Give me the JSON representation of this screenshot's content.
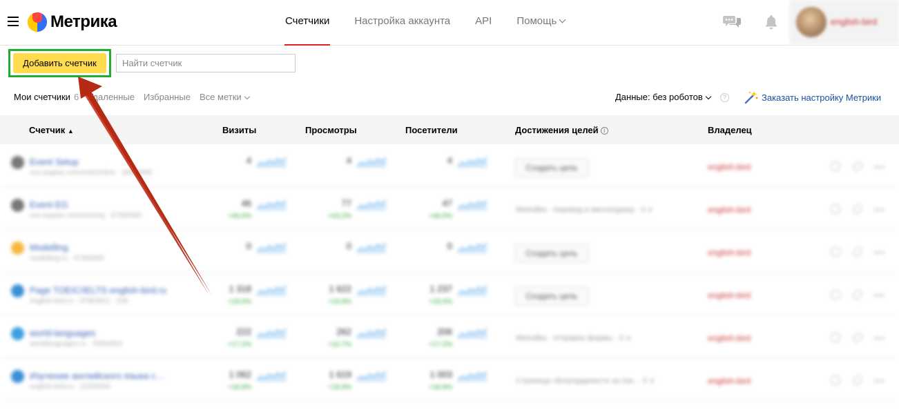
{
  "header": {
    "logo_text": "Метрика",
    "nav": [
      {
        "label": "Счетчики",
        "active": true
      },
      {
        "label": "Настройка аккаунта",
        "active": false
      },
      {
        "label": "API",
        "active": false
      },
      {
        "label": "Помощь",
        "active": false,
        "dropdown": true
      }
    ],
    "icons": [
      "chat-icon",
      "bell-icon"
    ],
    "profile_name": "english-bird"
  },
  "toolbar": {
    "add_button_label": "Добавить счетчик",
    "search_placeholder": "Найти счетчик",
    "highlight_color": "#1fae2f",
    "add_button_color": "#ffdb4d"
  },
  "tabs": [
    {
      "label": "Мои счетчики",
      "count": "6",
      "active": true
    },
    {
      "label": "Удаленные",
      "active": false
    },
    {
      "label": "Избранные",
      "active": false
    },
    {
      "label": "Все метки",
      "active": false,
      "dropdown": true
    }
  ],
  "data_filter": "Данные: без роботов",
  "help_symbol": "?",
  "order_link": "Заказать настройку Метрики",
  "table": {
    "columns": {
      "counter": "Счетчик",
      "sort_indicator": "▲",
      "visits": "Визиты",
      "views": "Просмотры",
      "visitors": "Посетители",
      "goals": "Достижения целей",
      "goals_info": "i",
      "owner": "Владелец"
    },
    "rows": [
      {
        "name": "Event Setup",
        "sub": "сoo.яндекс.ru/events/online · 26959466",
        "visits": "4",
        "views": "4",
        "visitors": "4",
        "visits_delta": "",
        "views_delta": "",
        "visitors_delta": "",
        "goal_button": "Создать цель",
        "goal_text": "",
        "owner": "english-bird",
        "icon_color": "#777"
      },
      {
        "name": "Event EG",
        "sub": "сoo.яндекс.ru/events/eg · 57690666",
        "visits": "46",
        "views": "77",
        "visitors": "47",
        "visits_delta": "+46.0%",
        "views_delta": "+43.2%",
        "visitors_delta": "+46.0%",
        "goal_button": "",
        "goal_text": "Metodika · перевод в мессенджер · 0 ∨",
        "owner": "english-bird",
        "icon_color": "#777"
      },
      {
        "name": "Modelling",
        "sub": "modelling.ru · 47365493",
        "visits": "0",
        "views": "0",
        "visitors": "0",
        "visits_delta": "",
        "views_delta": "",
        "visitors_delta": "",
        "goal_button": "Создать цель",
        "goal_text": "",
        "owner": "english-bird",
        "icon_color": "#f7b73e"
      },
      {
        "name": "Page TOEIC/IELTS english-bird.ru",
        "sub": "english-bird.ru · 37952821 · 518",
        "visits": "1 318",
        "views": "1 622",
        "visitors": "1 237",
        "visits_delta": "+18.0%",
        "views_delta": "+16.9%",
        "visitors_delta": "+18.0%",
        "goal_button": "Создать цель",
        "goal_text": "",
        "owner": "english-bird",
        "icon_color": "#3a8fd6"
      },
      {
        "name": "world-languages",
        "sub": "worldlanguages.ru · 25504921",
        "visits": "222",
        "views": "262",
        "visitors": "206",
        "visits_delta": "+17.2%",
        "views_delta": "+10.7%",
        "visitors_delta": "+17.2%",
        "goal_button": "",
        "goal_text": "Metodika · отправка формы · 0 ∨",
        "owner": "english-bird",
        "icon_color": "#3a9fe0"
      },
      {
        "name": "Изучение английского языка с…",
        "sub": "english-bird.ru · 21525334",
        "visits": "1 062",
        "views": "1 619",
        "visitors": "1 003",
        "visits_delta": "+18.9%",
        "views_delta": "+18.9%",
        "visitors_delta": "+18.9%",
        "goal_button": "",
        "goal_text": "Страница «Благодарности за пок…   0 ∨",
        "owner": "english-bird",
        "icon_color": "#3a8fd6"
      }
    ]
  }
}
